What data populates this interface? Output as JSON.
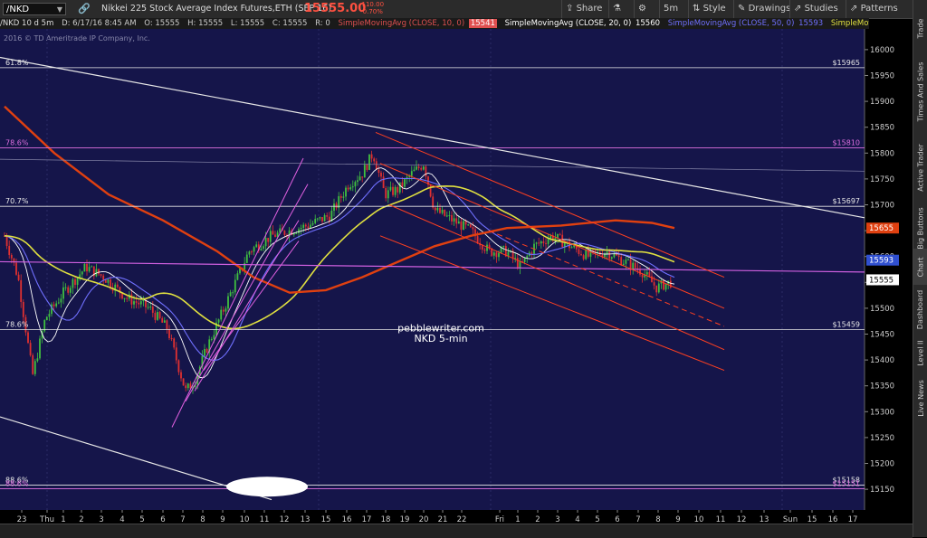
{
  "toolbar": {
    "symbol": "/NKD",
    "title": "Nikkei 225 Stock Average Index Futures,ETH (SEP 16)",
    "price": "15555.00",
    "change": "-110.00",
    "change_pct": "-0.70%",
    "share_label": "Share",
    "interval_label": "5m",
    "style_label": "Style",
    "drawings_label": "Drawings",
    "studies_label": "Studies",
    "patterns_label": "Patterns"
  },
  "ohlc": {
    "period": "/NKD 10 d 5m",
    "date": "D: 6/17/16 8:45 AM",
    "open": "O: 15555",
    "high": "H: 15555",
    "low": "L: 15555",
    "close": "C: 15555",
    "range": "R: 0",
    "sma10": "SimpleMovingAvg (CLOSE, 10, 0)",
    "sma10_val": "15541",
    "sma20": "SimpleMovingAvg (CLOSE, 20, 0)",
    "sma20_val": "15560",
    "sma50": "SimpleMovingAvg (CLOSE, 50, 0)",
    "sma50_val": "15593",
    "sma200": "SimpleMovingAvg (CLOSE,..."
  },
  "copyright": "2016 © TD Ameritrade IP Company, Inc.",
  "sidebar": [
    "Trade",
    "Times And Sales",
    "Active Trader",
    "Big Buttons",
    "Chart",
    "Dashboard",
    "Level II",
    "Live News"
  ],
  "chart_data": {
    "type": "candlestick",
    "annotation": [
      "pebblewriter.com",
      "NKD 5-min"
    ],
    "y_range": [
      15110,
      16040
    ],
    "y_ticks": [
      16000,
      15950,
      15900,
      15850,
      15800,
      15750,
      15700,
      15650,
      15600,
      15550,
      15500,
      15450,
      15400,
      15350,
      15300,
      15250,
      15200,
      15150
    ],
    "x_ticks": [
      "23",
      "Thu",
      "1",
      "2",
      "3",
      "4",
      "5",
      "6",
      "7",
      "8",
      "9",
      "10",
      "11",
      "12",
      "13",
      "15",
      "16",
      "17",
      "18",
      "19",
      "20",
      "21",
      "22",
      "Fri",
      "1",
      "2",
      "3",
      "4",
      "5",
      "6",
      "7",
      "8",
      "9",
      "10",
      "11",
      "12",
      "13",
      "Sun",
      "15",
      "16",
      "17"
    ],
    "fib_levels": [
      {
        "label": "61.8%",
        "price": 15965,
        "value_label": "$15965",
        "color": "#e8e8e8"
      },
      {
        "label": "78.6%",
        "price": 15810,
        "value_label": "$15810",
        "color": "#e070e0"
      },
      {
        "label": "70.7%",
        "price": 15697,
        "value_label": "$15697",
        "color": "#e8e8e8"
      },
      {
        "label": "78.6%",
        "price": 15459,
        "value_label": "$15459",
        "color": "#e8e8e8"
      },
      {
        "label": "88.6%",
        "price": 15158,
        "value_label": "$15158",
        "color": "#e8e8e8"
      },
      {
        "label": "88.6%",
        "price": 15151,
        "value_label": "$15151",
        "color": "#e070e0"
      }
    ],
    "price_labels": [
      {
        "value": "15655",
        "price": 15655,
        "bg": "#e04010",
        "fg": "#ffffff"
      },
      {
        "value": "15593",
        "price": 15593,
        "bg": "#3050d0",
        "fg": "#ffffff"
      },
      {
        "value": "15555",
        "price": 15555,
        "bg": "#ffffff",
        "fg": "#000000"
      }
    ],
    "series": [
      {
        "name": "SMA 10",
        "color": "#ffffff"
      },
      {
        "name": "SMA 20",
        "color": "#e05050"
      },
      {
        "name": "SMA 50",
        "color": "#7070ff"
      },
      {
        "name": "SMA 200",
        "color": "#e0e040"
      }
    ],
    "colors": {
      "background": "#15154a",
      "up": "#40c040",
      "down": "#e03030",
      "channel": "#ff4020",
      "upchannel": "#e060e0"
    }
  }
}
